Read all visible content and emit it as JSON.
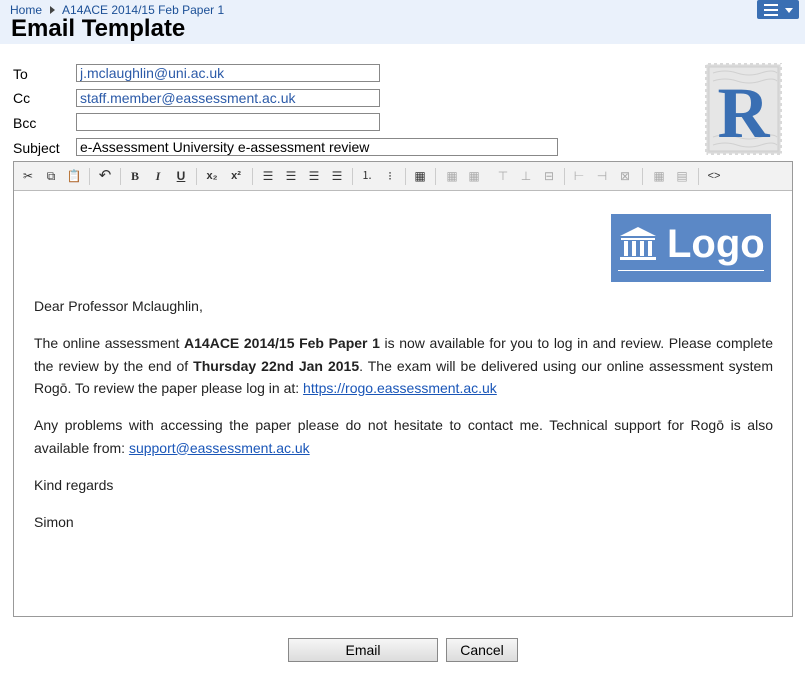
{
  "breadcrumb": {
    "home": "Home",
    "current": "A14ACE 2014/15 Feb Paper 1"
  },
  "page_title": "Email Template",
  "form": {
    "to_label": "To",
    "to_value": "j.mclaughlin@uni.ac.uk",
    "cc_label": "Cc",
    "cc_value": "staff.member@eassessment.ac.uk",
    "bcc_label": "Bcc",
    "bcc_value": "",
    "subject_label": "Subject",
    "subject_value": "e-Assessment University e-assessment review"
  },
  "stamp": {
    "letter": "R",
    "color": "#3a6fb3"
  },
  "logo": {
    "text": "Logo",
    "color": "#5b88c6"
  },
  "toolbar_icons": [
    "cut-icon",
    "copy-icon",
    "paste-icon",
    "undo-icon",
    "bold-icon",
    "italic-icon",
    "underline-icon",
    "subscript-icon",
    "superscript-icon",
    "align-left-icon",
    "align-center-icon",
    "align-right-icon",
    "justify-icon",
    "numbered-list-icon",
    "bullet-list-icon",
    "table-edit-icon",
    "table-icon",
    "merge-cells-icon",
    "insert-row-before-icon",
    "insert-row-after-icon",
    "delete-row-icon",
    "insert-col-before-icon",
    "insert-col-after-icon",
    "delete-col-icon",
    "split-cells-icon",
    "cell-props-icon",
    "source-code-icon"
  ],
  "body": {
    "greeting": "Dear Professor Mclaughlin,",
    "p1_a": "The online assessment ",
    "p1_b": "A14ACE 2014/15 Feb Paper 1",
    "p1_c": " is now available for you to log in and review. Please complete the review by the end of ",
    "p1_d": "Thursday 22nd Jan 2015",
    "p1_e": ". The exam will be delivered using our online assessment system Rogō. To review the paper please log in at: ",
    "p1_link": "https://rogo.eassessment.ac.uk",
    "p2_a": "Any problems with accessing the paper please do not hesitate to contact me. Technical support for Rogō is also available from: ",
    "p2_link": "support@eassessment.ac.uk",
    "closing": "Kind regards",
    "signature": "Simon"
  },
  "buttons": {
    "email": "Email",
    "cancel": "Cancel"
  }
}
